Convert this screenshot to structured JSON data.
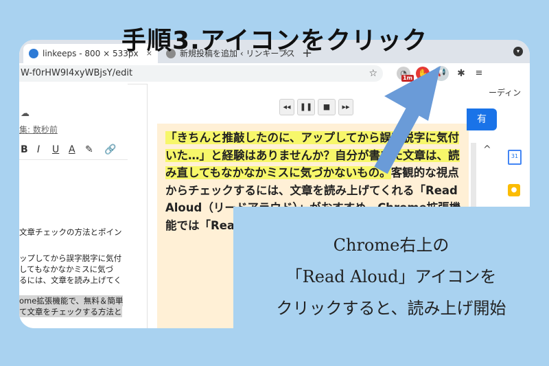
{
  "title": "手順3.アイコンをクリック",
  "browser": {
    "active_tab": "linkeeps - 800 × 533px",
    "inactive_tab": "新規投稿を追加 ‹ リンキープス —",
    "close_glyph": "×",
    "new_tab_glyph": "+",
    "url": "W-f0rHW9I4xyWBjsY/edit",
    "star_glyph": "☆",
    "badge": "1m",
    "puzzle_glyph": "✱",
    "list_glyph": "≡"
  },
  "doc": {
    "edited": "集: 数秒前",
    "format_buttons": [
      "B",
      "I",
      "U",
      "A",
      "✎"
    ],
    "lines": [
      "文章チェックの方法とポイン",
      "ップしてから誤字脱字に気付",
      "してもなかなかミスに気づ",
      "るには、文章を読み上げてく",
      "ome拡張機能で、無料＆簡単",
      "て文章をチェックする方法と"
    ],
    "menu_item": "ーディン",
    "share": "有",
    "chevron": "^"
  },
  "reader": {
    "controls": [
      "◂◂",
      "❚❚",
      "■",
      "▸▸"
    ],
    "highlight": "「きちんと推敲したのに、アップしてから誤字脱字に気付いた…」と経験はありませんか？自分が書いた文章は、読み直してもなかなかミスに気づかないもの。",
    "rest": "客観的な視点からチェックするには、文章を読み上げてくれる「Read Aloud（リードアラウド）」がおすすめ。Chrome拡張機能では「Read Aloud」とポイントを紹"
  },
  "callout": {
    "line1": "Chrome右上の",
    "line2": "「Read Aloud」アイコンを",
    "line3": "クリックすると、読み上げ開始"
  },
  "colors": {
    "background": "#a9d2f0",
    "highlight": "#f7f76a",
    "reader_bg": "#fff0d6",
    "arrow": "#6a9bd8"
  }
}
